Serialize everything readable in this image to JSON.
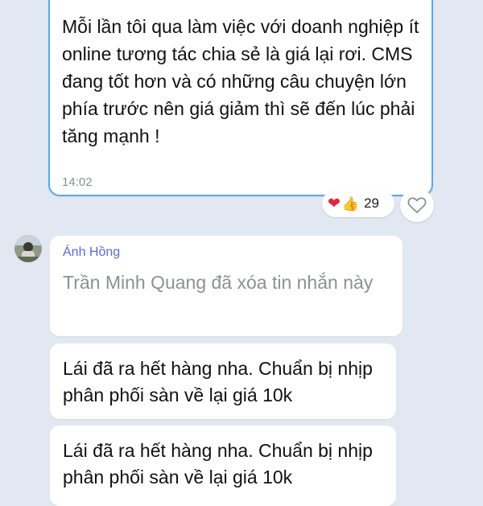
{
  "my_message": {
    "text": "Mỗi lần tôi qua làm việc với doanh nghiệp ít online tương tác chia sẻ là giá lại rơi. CMS đang tốt hơn và có những câu chuyện lớn phía trước nên giá giảm thì sẽ đến lúc phải tăng mạnh !",
    "time": "14:02",
    "reactions": {
      "emojis": [
        "red-heart",
        "thumbs-up"
      ],
      "count": "29"
    }
  },
  "incoming": [
    {
      "sender": "Ánh Hồng",
      "text": "Trần Minh Quang đã xóa tin nhắn này",
      "deleted": true
    },
    {
      "text": "Lái đã ra hết hàng nha. Chuẩn bị nhịp phân phối sàn về lại giá 10k"
    },
    {
      "text": "Lái đã ra hết hàng nha. Chuẩn bị nhịp phân phối sàn về lại giá 10k"
    }
  ],
  "colors": {
    "background": "#e2e8f1",
    "selected_border": "#5aa8ec",
    "sender_name": "#5b6ad0",
    "deleted_text": "#8d9096"
  }
}
